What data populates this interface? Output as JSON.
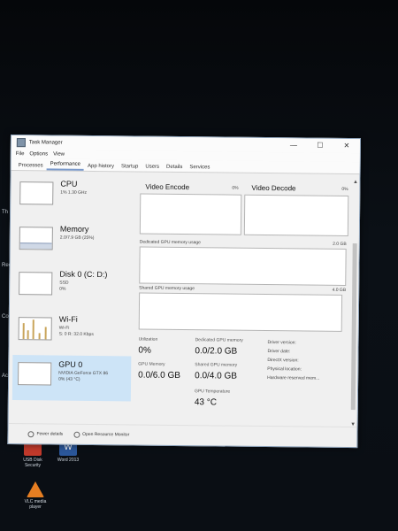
{
  "window": {
    "title": "Task Manager",
    "controls": {
      "minimize": "—",
      "maximize": "☐",
      "close": "✕"
    }
  },
  "menu": [
    "File",
    "Options",
    "View"
  ],
  "tabs": [
    "Processes",
    "Performance",
    "App history",
    "Startup",
    "Users",
    "Details",
    "Services"
  ],
  "active_tab": "Performance",
  "sidebar": [
    {
      "name": "CPU",
      "sub1": "1% 1.30 GHz",
      "sub2": "",
      "thumb": "cpu"
    },
    {
      "name": "Memory",
      "sub1": "2.0/7.9 GB (25%)",
      "sub2": "",
      "thumb": "mem"
    },
    {
      "name": "Disk 0 (C: D:)",
      "sub1": "SSD",
      "sub2": "0%",
      "thumb": "disk"
    },
    {
      "name": "Wi-Fi",
      "sub1": "Wi-Fi",
      "sub2": "S: 0 R: 32.0 Kbps",
      "thumb": "wifi"
    },
    {
      "name": "GPU 0",
      "sub1": "NVIDIA GeForce GTX 86",
      "sub2": "0% (43 °C)",
      "thumb": "gpu",
      "selected": true
    }
  ],
  "main": {
    "video_encode": {
      "label": "Video Encode",
      "pct": "0%"
    },
    "video_decode": {
      "label": "Video Decode",
      "pct": "0%"
    },
    "dedicated_usage": {
      "label": "Dedicated GPU memory usage",
      "max": "2.0 GB"
    },
    "shared_usage": {
      "label": "Shared GPU memory usage",
      "max": "4.0 GB"
    },
    "stats": {
      "utilization": {
        "label": "Utilization",
        "value": "0%"
      },
      "dedicated": {
        "label": "Dedicated GPU memory",
        "value": "0.0/2.0 GB"
      },
      "gpu_memory": {
        "label": "GPU Memory",
        "value": "0.0/6.0 GB"
      },
      "shared": {
        "label": "Shared GPU memory",
        "value": "0.0/4.0 GB"
      },
      "temperature": {
        "label": "GPU Temperature",
        "value": "43 °C"
      }
    },
    "details": [
      "Driver version:",
      "Driver date:",
      "DirectX version:",
      "Physical location:",
      "Hardware reserved mem..."
    ]
  },
  "footer": {
    "fewer_details": "Fewer details",
    "resource_monitor": "Open Resource Monitor"
  },
  "desktop": {
    "icons": [
      {
        "label": "USB Disk Security",
        "color": "#c0392b"
      },
      {
        "label": "Word 2013",
        "color": "#2b579a"
      },
      {
        "label": "VLC media player",
        "color": "#e67e22"
      }
    ],
    "left_fragments": [
      "Th",
      "Rec",
      "Cont",
      "Acc"
    ]
  },
  "colors": {
    "selected": "#cde4f7",
    "tab_underline": "#7b9acb"
  }
}
